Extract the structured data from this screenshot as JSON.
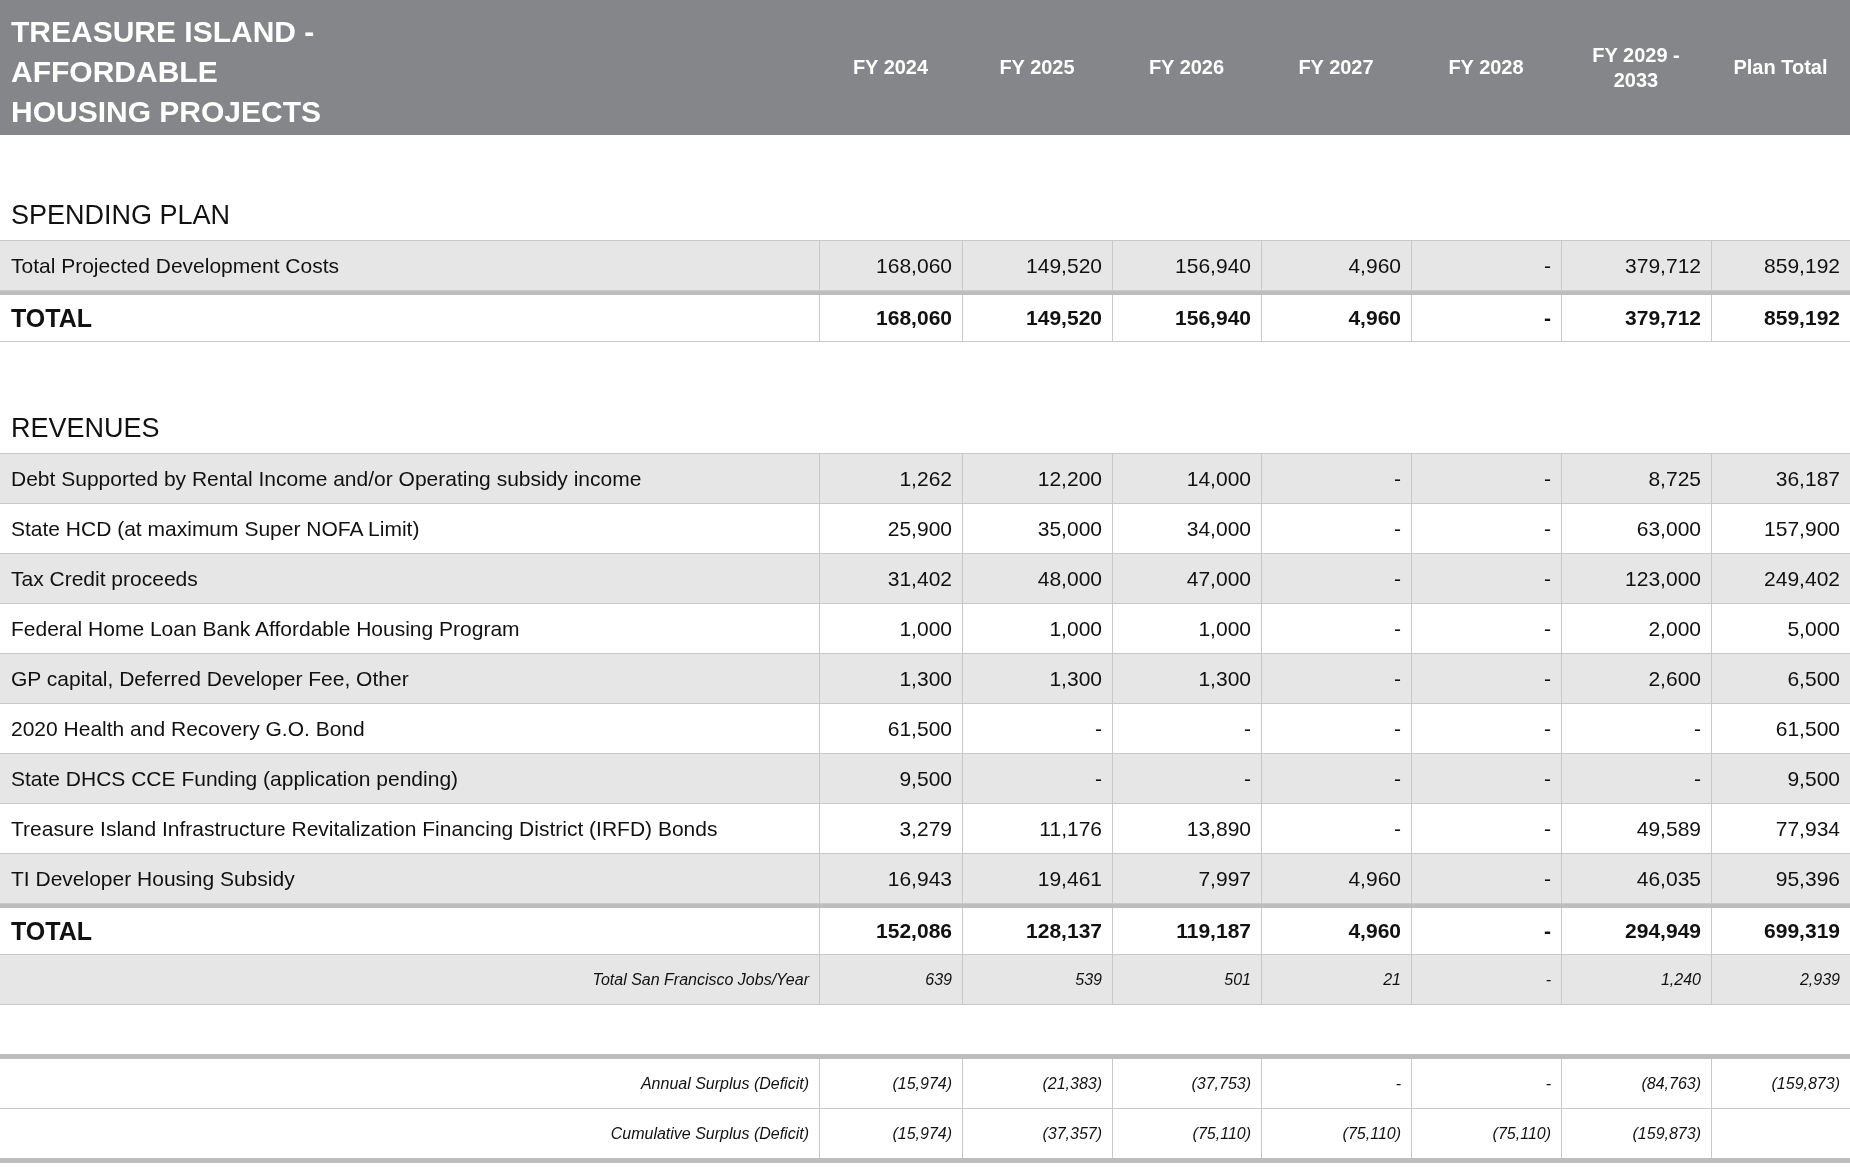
{
  "title_lines": [
    "TREASURE ISLAND -",
    "AFFORDABLE",
    "HOUSING PROJECTS"
  ],
  "columns": [
    "FY 2024",
    "FY 2025",
    "FY 2026",
    "FY 2027",
    "FY 2028",
    "FY 2029 - 2033",
    "Plan Total"
  ],
  "sections": [
    {
      "heading": "SPENDING PLAN",
      "rows": [
        {
          "kind": "item",
          "label": "Total Projected Development Costs",
          "values": [
            "168,060",
            "149,520",
            "156,940",
            "4,960",
            "-",
            "379,712",
            "859,192"
          ]
        },
        {
          "kind": "total",
          "label": "TOTAL",
          "values": [
            "168,060",
            "149,520",
            "156,940",
            "4,960",
            "-",
            "379,712",
            "859,192"
          ]
        }
      ]
    },
    {
      "heading": "REVENUES",
      "rows": [
        {
          "kind": "item",
          "label": "Debt Supported by Rental Income and/or Operating subsidy income",
          "values": [
            "1,262",
            "12,200",
            "14,000",
            "-",
            "-",
            "8,725",
            "36,187"
          ]
        },
        {
          "kind": "item",
          "label": "State HCD (at maximum Super NOFA Limit)",
          "values": [
            "25,900",
            "35,000",
            "34,000",
            "-",
            "-",
            "63,000",
            "157,900"
          ]
        },
        {
          "kind": "item",
          "label": "Tax Credit proceeds",
          "values": [
            "31,402",
            "48,000",
            "47,000",
            "-",
            "-",
            "123,000",
            "249,402"
          ]
        },
        {
          "kind": "item",
          "label": "Federal Home Loan Bank Affordable Housing Program",
          "values": [
            "1,000",
            "1,000",
            "1,000",
            "-",
            "-",
            "2,000",
            "5,000"
          ]
        },
        {
          "kind": "item",
          "label": "GP capital, Deferred Developer Fee, Other",
          "values": [
            "1,300",
            "1,300",
            "1,300",
            "-",
            "-",
            "2,600",
            "6,500"
          ]
        },
        {
          "kind": "item",
          "label": "2020 Health and Recovery G.O. Bond",
          "values": [
            "61,500",
            "-",
            "-",
            "-",
            "-",
            "-",
            "61,500"
          ]
        },
        {
          "kind": "item",
          "label": "State DHCS CCE Funding (application pending)",
          "values": [
            "9,500",
            "-",
            "-",
            "-",
            "-",
            "-",
            "9,500"
          ]
        },
        {
          "kind": "item",
          "label": "Treasure Island Infrastructure Revitalization Financing District (IRFD) Bonds",
          "values": [
            "3,279",
            "11,176",
            "13,890",
            "-",
            "-",
            "49,589",
            "77,934"
          ]
        },
        {
          "kind": "item",
          "label": "TI Developer Housing Subsidy",
          "values": [
            "16,943",
            "19,461",
            "7,997",
            "4,960",
            "-",
            "46,035",
            "95,396"
          ]
        },
        {
          "kind": "total",
          "label": "TOTAL",
          "values": [
            "152,086",
            "128,137",
            "119,187",
            "4,960",
            "-",
            "294,949",
            "699,319"
          ]
        },
        {
          "kind": "summary",
          "label": "Total San Francisco Jobs/Year",
          "values": [
            "639",
            "539",
            "501",
            "21",
            "-",
            "1,240",
            "2,939"
          ]
        }
      ]
    },
    {
      "rows": [
        {
          "kind": "note",
          "label": "Annual Surplus (Deficit)",
          "values": [
            "(15,974)",
            "(21,383)",
            "(37,753)",
            "-",
            "-",
            "(84,763)",
            "(159,873)"
          ]
        },
        {
          "kind": "note",
          "label": "Cumulative Surplus (Deficit)",
          "values": [
            "(15,974)",
            "(37,357)",
            "(75,110)",
            "(75,110)",
            "(75,110)",
            "(159,873)"
          ]
        }
      ]
    }
  ]
}
